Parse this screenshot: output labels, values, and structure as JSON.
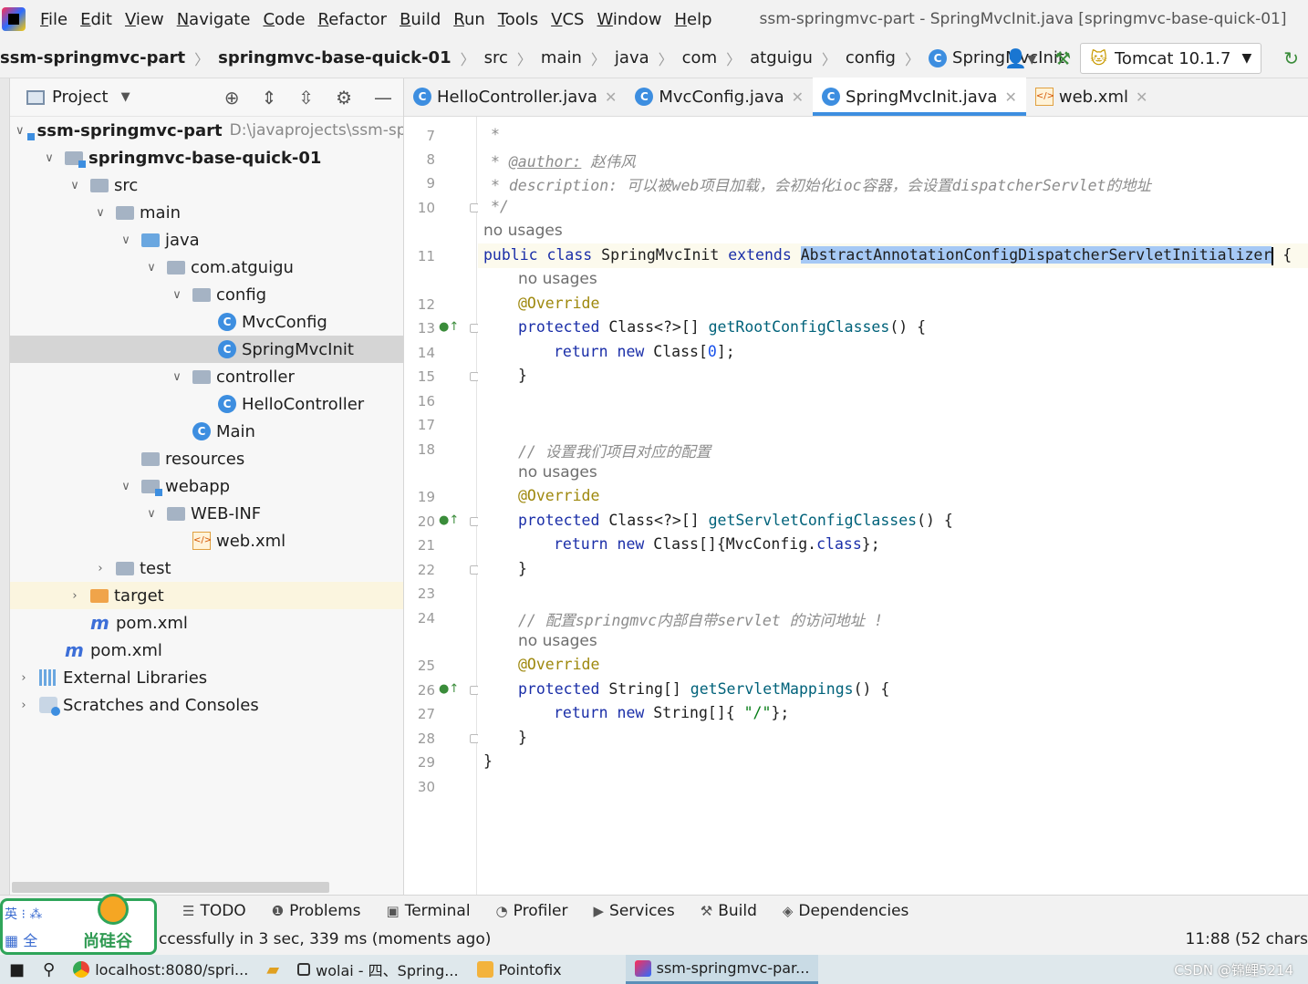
{
  "menu": {
    "items": [
      "File",
      "Edit",
      "View",
      "Navigate",
      "Code",
      "Refactor",
      "Build",
      "Run",
      "Tools",
      "VCS",
      "Window",
      "Help"
    ],
    "window_title": "ssm-springmvc-part - SpringMvcInit.java [springmvc-base-quick-01]"
  },
  "breadcrumb": {
    "items": [
      "ssm-springmvc-part",
      "springmvc-base-quick-01",
      "src",
      "main",
      "java",
      "com",
      "atguigu",
      "config",
      "SpringMvcInit"
    ]
  },
  "run_config": {
    "label": "Tomcat 10.1.7"
  },
  "project_panel": {
    "title": "Project",
    "tree": [
      {
        "label": "ssm-springmvc-part",
        "path": "D:\\javaprojects\\ssm-spr"
      },
      {
        "label": "springmvc-base-quick-01"
      },
      {
        "label": "src"
      },
      {
        "label": "main"
      },
      {
        "label": "java"
      },
      {
        "label": "com.atguigu"
      },
      {
        "label": "config"
      },
      {
        "label": "MvcConfig"
      },
      {
        "label": "SpringMvcInit"
      },
      {
        "label": "controller"
      },
      {
        "label": "HelloController"
      },
      {
        "label": "Main"
      },
      {
        "label": "resources"
      },
      {
        "label": "webapp"
      },
      {
        "label": "WEB-INF"
      },
      {
        "label": "web.xml"
      },
      {
        "label": "test"
      },
      {
        "label": "target"
      },
      {
        "label": "pom.xml"
      },
      {
        "label": "pom.xml"
      },
      {
        "label": "External Libraries"
      },
      {
        "label": "Scratches and Consoles"
      }
    ]
  },
  "tabs": [
    {
      "label": "HelloController.java"
    },
    {
      "label": "MvcConfig.java"
    },
    {
      "label": "SpringMvcInit.java"
    },
    {
      "label": "web.xml"
    }
  ],
  "editor": {
    "line_numbers": [
      "7",
      "8",
      "9",
      "10",
      "11",
      "12",
      "13",
      "14",
      "15",
      "16",
      "17",
      "18",
      "19",
      "20",
      "21",
      "22",
      "23",
      "24",
      "25",
      "26",
      "27",
      "28",
      "29",
      "30"
    ],
    "doc_star": "*",
    "author_tag": "@author:",
    "author_name": "赵伟风",
    "desc_line": "* description: 可以被web项目加载，会初始化ioc容器，会设置dispatcherServlet的地址",
    "doc_end": "*/",
    "no_usages": "no usages",
    "class_kw": "public class",
    "class_name": "SpringMvcInit",
    "extends_kw": "extends",
    "super_class": "AbstractAnnotationConfigDispatcherServletInitializer",
    "open_brace": "{",
    "override": "@Override",
    "protected_kw": "protected",
    "class_arr_type": "Class<?>[]",
    "m_root": "getRootConfigClasses",
    "m_parens": "() {",
    "return_new": "return new",
    "ret_root_pre": "Class[",
    "ret_root_num": "0",
    "ret_root_post": "];",
    "close_brace": "}",
    "cmt_config": "// 设置我们项目对应的配置",
    "m_servlet_cfg": "getServletConfigClasses",
    "ret_cfg_pre": "Class[]{MvcConfig.",
    "ret_cfg_kw": "class",
    "ret_cfg_post": "};",
    "cmt_mapping": "// 配置springmvc内部自带servlet 的访问地址 !",
    "string_arr_type": "String[]",
    "m_mappings": "getServletMappings",
    "ret_map_pre": "String[]{ ",
    "ret_map_str": "\"/\"",
    "ret_map_post": "};"
  },
  "tool_windows": [
    "TODO",
    "Problems",
    "Terminal",
    "Profiler",
    "Services",
    "Build",
    "Dependencies"
  ],
  "status": {
    "message": "ccessfully in 3 sec, 339 ms (moments ago)",
    "position": "11:88 (52 chars"
  },
  "brand": {
    "icons": "英 ⁝ ⁂",
    "bottom": "▦ 全",
    "name": "尚硅谷"
  },
  "taskbar": {
    "items": [
      "localhost:8080/spri...",
      "wolai - 四、Spring...",
      "Pointofix",
      "ssm-springmvc-par..."
    ]
  },
  "watermark": "CSDN @锦鲤5214"
}
